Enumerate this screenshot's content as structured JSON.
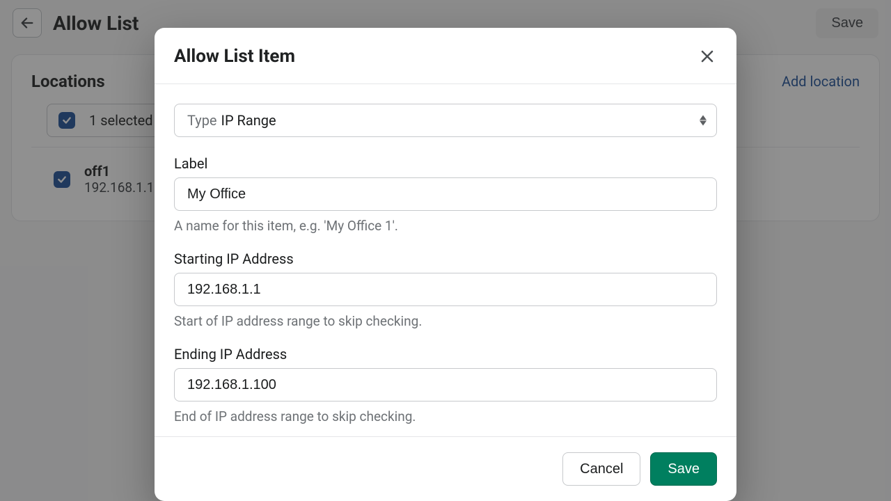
{
  "header": {
    "title": "Allow List",
    "save_label": "Save"
  },
  "card": {
    "title": "Locations",
    "add_label": "Add location",
    "selected_label": "1 selected",
    "items": [
      {
        "name": "off1",
        "ip": "192.168.1.1",
        "checked": true
      }
    ]
  },
  "modal": {
    "title": "Allow List Item",
    "type_prefix": "Type",
    "type_value": "IP Range",
    "label_label": "Label",
    "label_value": "My Office",
    "label_hint": "A name for this item, e.g. 'My Office 1'.",
    "start_label": "Starting IP Address",
    "start_value": "192.168.1.1",
    "start_hint": "Start of IP address range to skip checking.",
    "end_label": "Ending IP Address",
    "end_value": "192.168.1.100",
    "end_hint": "End of IP address range to skip checking.",
    "cancel_label": "Cancel",
    "save_label": "Save"
  }
}
